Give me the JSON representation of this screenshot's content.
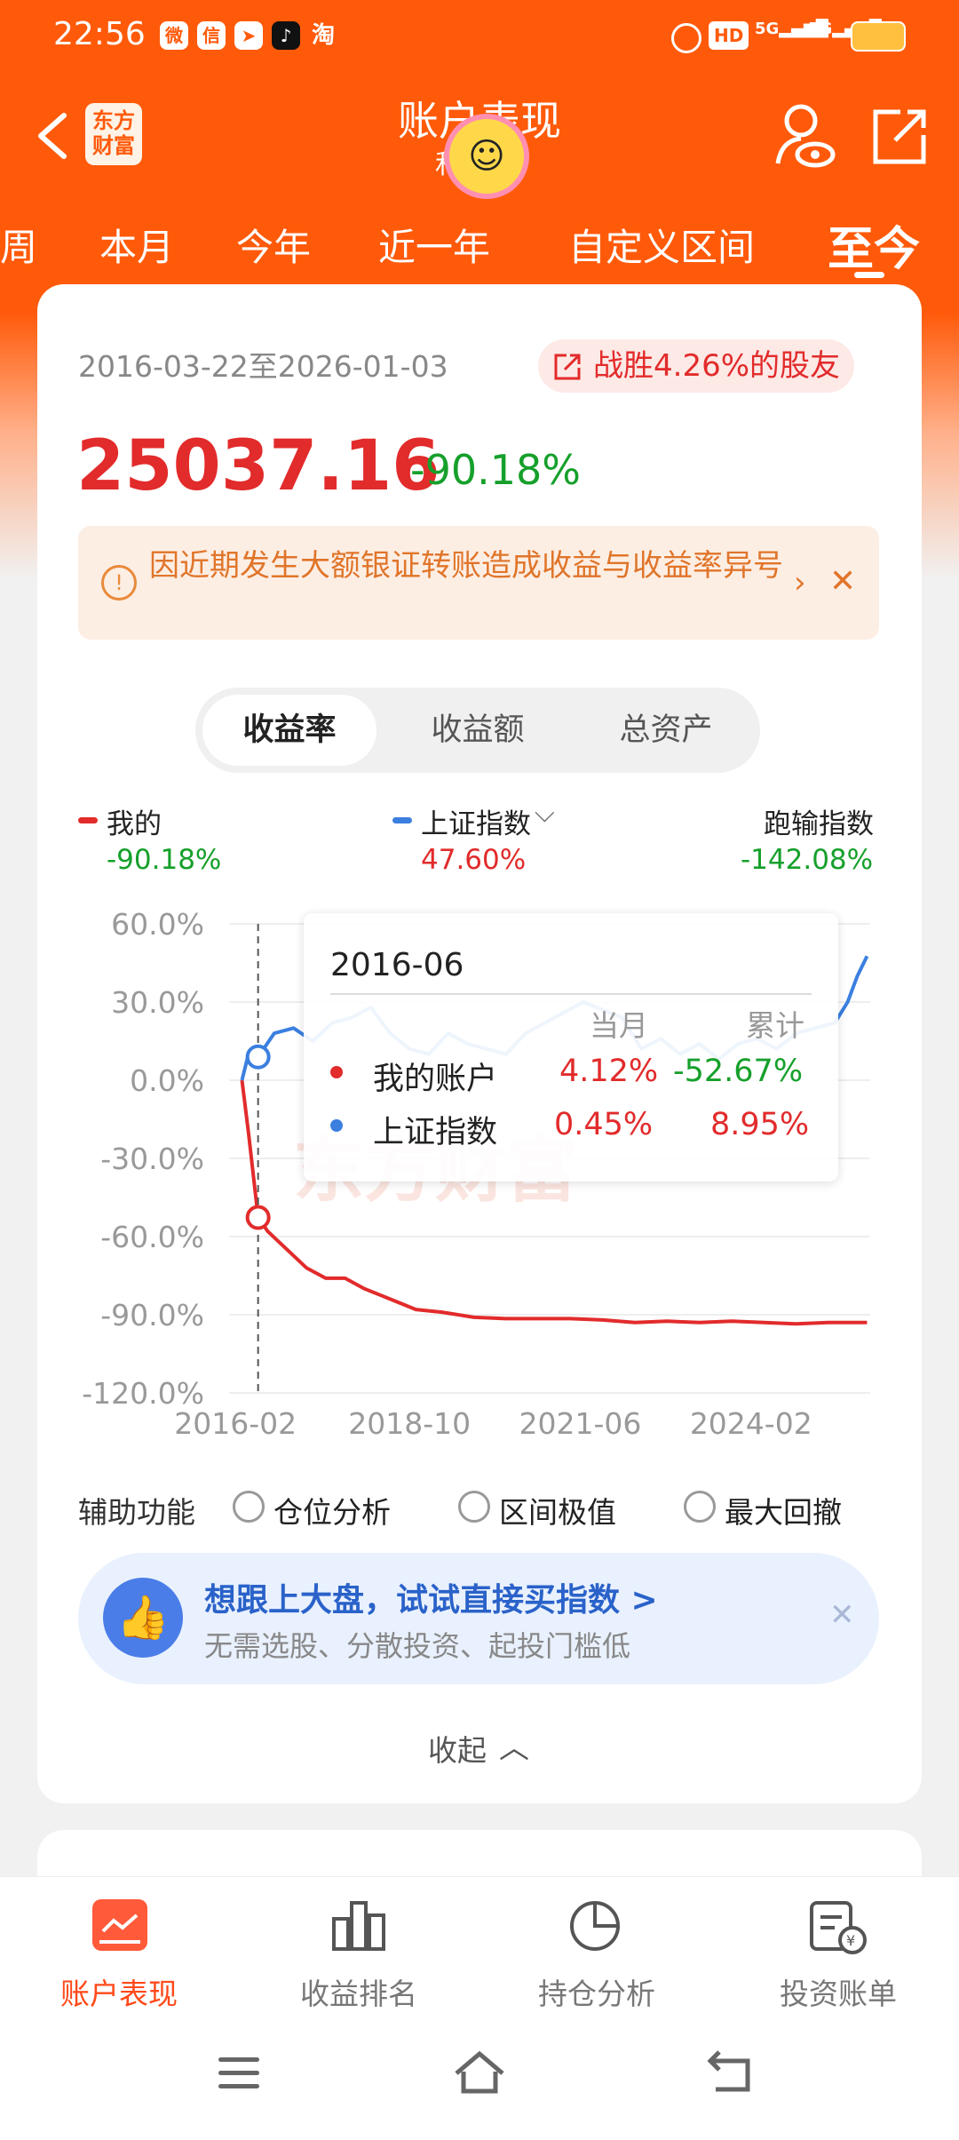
{
  "status_bar": {
    "time": "22:56",
    "icons": [
      "weibo-icon",
      "wechat-icon",
      "telegram-icon",
      "tiktok-icon",
      "taobao-icon",
      "alarm-icon",
      "hd-icon",
      "signal-5g-icon",
      "signal-5g-icon",
      "battery-icon"
    ]
  },
  "header": {
    "title": "账户表现",
    "subtitle": "和",
    "logo": "东方\n财富"
  },
  "tabs": [
    "周",
    "本月",
    "今年",
    "近一年",
    "自定义区间",
    "至今"
  ],
  "summary": {
    "date_range": "2016-03-22至2026-01-03",
    "beat_label": "战胜4.26%的股友",
    "profit": "25037.16",
    "profit_rate": "-90.18%"
  },
  "notice": {
    "text": "因近期发生大额银证转账造成收益与收益率异号"
  },
  "segments": [
    "收益率",
    "收益额",
    "总资产"
  ],
  "legend": [
    {
      "label": "我的",
      "value": "-90.18%",
      "color": "#e22b2b"
    },
    {
      "label": "上证指数",
      "value": "47.60%",
      "color": "#3b7fe0"
    },
    {
      "label": "跑输指数",
      "value": "-142.08%"
    }
  ],
  "watermark": "东方财富",
  "chart_data": {
    "type": "line",
    "x_ticks": [
      "2016-02",
      "2018-10",
      "2021-06",
      "2024-02"
    ],
    "y_ticks": [
      "60.0%",
      "30.0%",
      "0.0%",
      "-30.0%",
      "-60.0%",
      "-90.0%",
      "-120.0%"
    ],
    "ylim": [
      -120,
      60
    ],
    "series": [
      {
        "name": "我的",
        "color": "#e22b2b",
        "points": [
          [
            2016.2,
            0
          ],
          [
            2016.3,
            -20
          ],
          [
            2016.45,
            -52.67
          ],
          [
            2016.6,
            -58
          ],
          [
            2016.9,
            -65
          ],
          [
            2017.2,
            -72
          ],
          [
            2017.5,
            -76
          ],
          [
            2017.8,
            -76
          ],
          [
            2018.1,
            -80
          ],
          [
            2018.5,
            -84
          ],
          [
            2018.9,
            -88
          ],
          [
            2019.3,
            -89
          ],
          [
            2019.8,
            -91
          ],
          [
            2020.3,
            -91.5
          ],
          [
            2020.8,
            -91.5
          ],
          [
            2021.3,
            -91.5
          ],
          [
            2021.8,
            -92
          ],
          [
            2022.3,
            -93
          ],
          [
            2022.8,
            -92.5
          ],
          [
            2023.3,
            -93
          ],
          [
            2023.8,
            -92.5
          ],
          [
            2024.3,
            -93
          ],
          [
            2024.8,
            -93.5
          ],
          [
            2025.3,
            -93
          ],
          [
            2025.9,
            -93
          ]
        ]
      },
      {
        "name": "上证指数",
        "color": "#3b7fe0",
        "points": [
          [
            2016.2,
            0
          ],
          [
            2016.3,
            10
          ],
          [
            2016.45,
            8.95
          ],
          [
            2016.7,
            18
          ],
          [
            2017.0,
            20
          ],
          [
            2017.3,
            15
          ],
          [
            2017.6,
            22
          ],
          [
            2017.9,
            24
          ],
          [
            2018.2,
            28
          ],
          [
            2018.5,
            18
          ],
          [
            2018.8,
            12
          ],
          [
            2019.1,
            10
          ],
          [
            2019.4,
            18
          ],
          [
            2019.7,
            14
          ],
          [
            2020.0,
            12
          ],
          [
            2020.3,
            10
          ],
          [
            2020.6,
            18
          ],
          [
            2020.9,
            22
          ],
          [
            2021.2,
            26
          ],
          [
            2021.5,
            30
          ],
          [
            2021.8,
            27
          ],
          [
            2022.1,
            24
          ],
          [
            2022.4,
            12
          ],
          [
            2022.7,
            16
          ],
          [
            2023.0,
            10
          ],
          [
            2023.3,
            14
          ],
          [
            2023.6,
            8
          ],
          [
            2023.9,
            14
          ],
          [
            2024.2,
            16
          ],
          [
            2024.5,
            12
          ],
          [
            2024.8,
            18
          ],
          [
            2025.1,
            20
          ],
          [
            2025.4,
            22
          ],
          [
            2025.6,
            30
          ],
          [
            2025.75,
            40
          ],
          [
            2025.9,
            47.6
          ]
        ]
      }
    ],
    "tooltip": {
      "date": "2016-06",
      "col_month": "当月",
      "col_total": "累计",
      "rows": [
        {
          "label": "我的账户",
          "month": "4.12%",
          "total": "-52.67%"
        },
        {
          "label": "上证指数",
          "month": "0.45%",
          "total": "8.95%"
        }
      ]
    }
  },
  "aux": {
    "label": "辅助功能",
    "options": [
      "仓位分析",
      "区间极值",
      "最大回撤"
    ]
  },
  "promo": {
    "title": "想跟上大盘，试试直接买指数 >",
    "subtitle": "无需选股、分散投资、起投门槛低"
  },
  "collapse": "收起",
  "bottom_nav": [
    {
      "label": "账户表现",
      "active": true
    },
    {
      "label": "收益排名"
    },
    {
      "label": "持仓分析"
    },
    {
      "label": "投资账单"
    }
  ],
  "colors": {
    "accent": "#ff5a0a",
    "red": "#e22b2b",
    "green": "#16a02b",
    "blue": "#3b7fe0"
  }
}
